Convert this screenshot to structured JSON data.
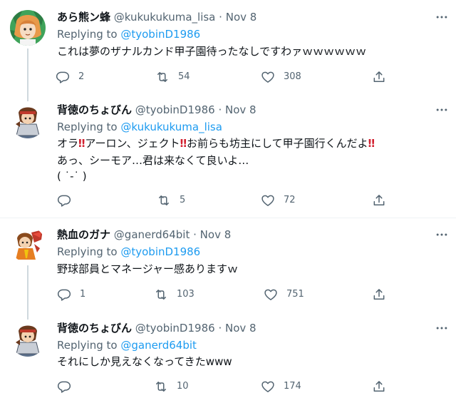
{
  "tweets": [
    {
      "name": "あら熊ン蜂",
      "handle": "@kukukukuma_lisa",
      "date": "Nov 8",
      "replying_label": "Replying to",
      "replying_to": "@tyobinD1986",
      "lines": [
        "これは夢のザナルカンド甲子園待ったなしですわァｗｗｗｗｗｗ"
      ],
      "replies": "2",
      "retweets": "54",
      "likes": "308"
    },
    {
      "name": "背徳のちょびん",
      "handle": "@tyobinD1986",
      "date": "Nov 8",
      "replying_label": "Replying to",
      "replying_to": "@kukukukuma_lisa",
      "line1_a": "オラ",
      "line1_b": "アーロン、ジェクト",
      "line1_c": "お前らも坊主にして甲子園行くんだよ",
      "bang": "‼",
      "line2": "あっ、シーモア…君は来なくて良いよ…",
      "line3": "( ˙-˙ )",
      "replies": "",
      "retweets": "5",
      "likes": "72"
    },
    {
      "name": "熱血のガナ",
      "handle": "@ganerd64bit",
      "date": "Nov 8",
      "replying_label": "Replying to",
      "replying_to": "@tyobinD1986",
      "lines": [
        "野球部員とマネージャー感ありますｗ"
      ],
      "replies": "1",
      "retweets": "103",
      "likes": "751"
    },
    {
      "name": "背徳のちょびん",
      "handle": "@tyobinD1986",
      "date": "Nov 8",
      "replying_label": "Replying to",
      "replying_to": "@ganerd64bit",
      "lines": [
        "それにしか見えなくなってきたwww"
      ],
      "replies": "",
      "retweets": "10",
      "likes": "174"
    }
  ],
  "separator": "·",
  "icons": {
    "reply": "reply-icon",
    "retweet": "retweet-icon",
    "like": "heart-icon",
    "share": "share-icon",
    "more": "more-icon"
  },
  "colors": {
    "link": "#1d9bf0",
    "muted": "#536471",
    "text": "#0f1419",
    "thread_line": "#cfd9de",
    "emphasis": "#d2202f"
  }
}
